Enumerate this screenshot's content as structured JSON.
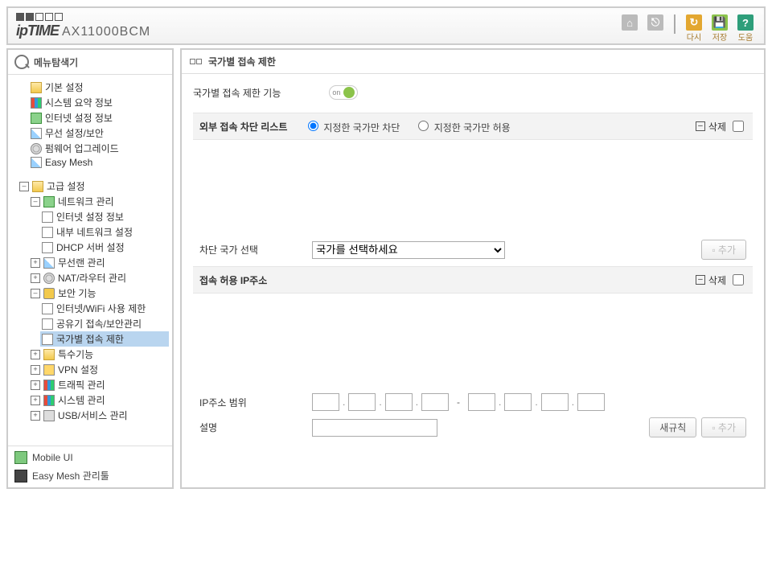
{
  "brand": {
    "ip": "ipTIME",
    "model": "AX11000BCM"
  },
  "topIcons": {
    "refresh": "다시",
    "save": "저장",
    "help": "도움"
  },
  "sidebar": {
    "title": "메뉴탐색기",
    "basic": {
      "label": "기본 설정",
      "items": [
        "시스템 요약 정보",
        "인터넷 설정 정보",
        "무선 설정/보안",
        "펌웨어 업그레이드",
        "Easy Mesh"
      ]
    },
    "advanced": {
      "label": "고급 설정",
      "network": {
        "label": "네트워크 관리",
        "items": [
          "인터넷 설정 정보",
          "내부 네트워크 설정",
          "DHCP 서버 설정"
        ]
      },
      "wireless": {
        "label": "무선랜 관리"
      },
      "nat": {
        "label": "NAT/라우터 관리"
      },
      "security": {
        "label": "보안 기능",
        "items": [
          "인터넷/WiFi 사용 제한",
          "공유기 접속/보안관리",
          "국가별 접속 제한"
        ]
      },
      "special": {
        "label": "특수기능"
      },
      "vpn": {
        "label": "VPN 설정"
      },
      "traffic": {
        "label": "트래픽 관리"
      },
      "system": {
        "label": "시스템 관리"
      },
      "usb": {
        "label": "USB/서비스 관리"
      }
    },
    "footer": {
      "mobile": "Mobile UI",
      "mesh": "Easy Mesh 관리툴"
    }
  },
  "content": {
    "title": "국가별 접속 제한",
    "feature": {
      "label": "국가별 접속 제한 기능",
      "state": "on"
    },
    "blockList": {
      "title": "외부 접속 차단 리스트",
      "opt1": "지정한 국가만 차단",
      "opt2": "지정한 국가만 허용",
      "delete": "삭제"
    },
    "country": {
      "label": "차단 국가 선택",
      "placeholder": "국가를 선택하세요",
      "add": "추가"
    },
    "allowList": {
      "title": "접속 허용 IP주소",
      "delete": "삭제"
    },
    "ipRange": {
      "label": "IP주소 범위"
    },
    "desc": {
      "label": "설명"
    },
    "actions": {
      "newRule": "새규칙",
      "add": "추가"
    }
  }
}
